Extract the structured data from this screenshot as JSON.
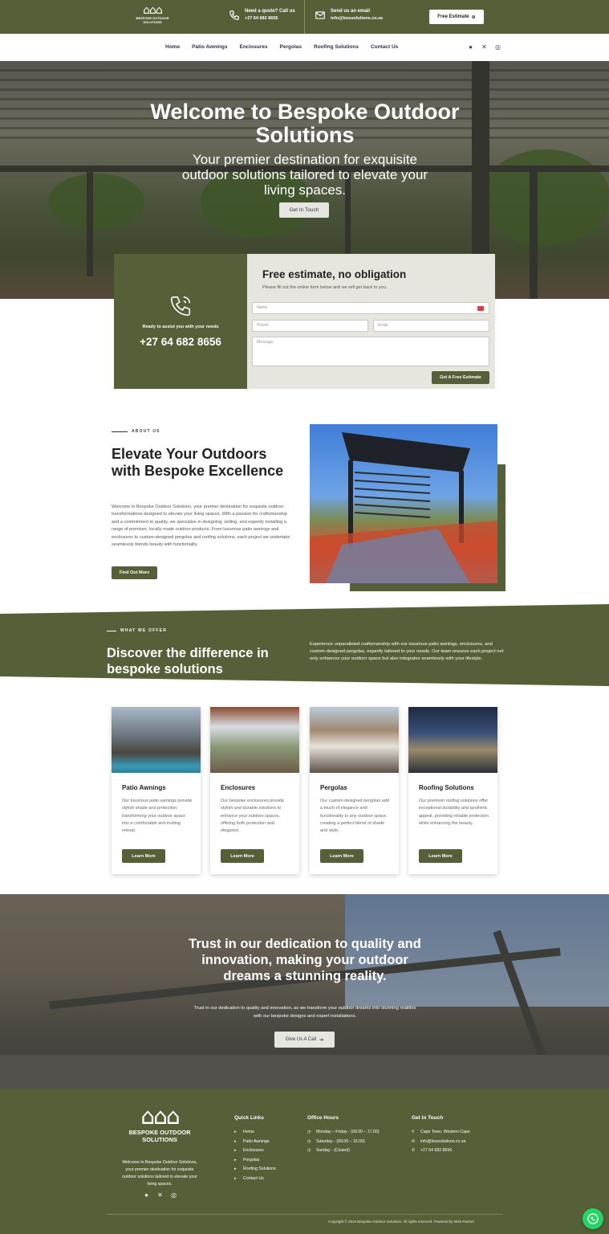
{
  "topbar": {
    "logo_text": "BESPOKE OUTDOOR SOLUTIONS",
    "quote_label": "Need a quote? Call us",
    "quote_phone": "+27 64 682 8656",
    "email_label": "Send us an email",
    "email_value": "info@bossolutions.co.za",
    "estimate_button": "Free Estimate"
  },
  "nav": {
    "items": [
      "Home",
      "Patio Awnings",
      "Enclosures",
      "Pergolas",
      "Roofing Solutions",
      "Contact Us"
    ],
    "social_icons": [
      "facebook-icon",
      "x-icon",
      "instagram-icon"
    ]
  },
  "hero": {
    "title": "Welcome to Bespoke Outdoor Solutions",
    "subtitle": "Your premier destination for exquisite outdoor solutions tailored to elevate your living spaces.",
    "button": "Get In Touch"
  },
  "estimate": {
    "ready_text": "Ready to assist you with your needs",
    "phone": "+27 64 682 8656",
    "title": "Free estimate, no obligation",
    "subtitle": "Please fill out the online form below and we will get back to you.",
    "name_placeholder": "Name",
    "phone_placeholder": "Phone",
    "email_placeholder": "Email",
    "message_placeholder": "Message",
    "submit": "Get A Free Estimate"
  },
  "about": {
    "label": "ABOUT US",
    "title": "Elevate Your Outdoors with Bespoke Excellence",
    "body": "Welcome to Bespoke Outdoor Solutions, your premier destination for exquisite outdoor transformations designed to elevate your living spaces. With a passion for craftsmanship and a commitment to quality, we specialize in designing, selling, and expertly installing a range of premium, locally made outdoor products. From luxurious patio awnings and enclosures to custom-designed pergolas and roofing solutions, each project we undertake seamlessly blends beauty with functionality.",
    "button": "Find Out More"
  },
  "offer": {
    "label": "WHAT WE OFFER",
    "title": "Discover the difference in bespoke solutions",
    "body": "Experience unparalleled craftsmanship with our luxurious patio awnings, enclosures, and custom-designed pergolas, expertly tailored to your needs. Our team ensures each project not only enhances your outdoor space but also integrates seamlessly with your lifestyle."
  },
  "services": [
    {
      "name": "Patio Awnings",
      "desc": "Our luxurious patio awnings provide stylish shade and protection, transforming your outdoor space into a comfortable and inviting retreat.",
      "button": "Learn More"
    },
    {
      "name": "Enclosures",
      "desc": "Our bespoke enclosures provide stylish and durable solutions to enhance your outdoor spaces, offering both protection and elegance.",
      "button": "Learn More"
    },
    {
      "name": "Pergolas",
      "desc": "Our custom-designed pergolas add a touch of elegance and functionality to any outdoor space, creating a perfect blend of shade and style.",
      "button": "Learn More"
    },
    {
      "name": "Roofing Solutions",
      "desc": "Our premium roofing solutions offer exceptional durability and aesthetic appeal, providing reliable protection while enhancing the beauty.",
      "button": "Learn More"
    }
  ],
  "trust": {
    "title": "Trust in our dedication to quality and innovation, making your outdoor dreams a stunning reality.",
    "body": "Trust in our dedication to quality and innovation, as we transform your outdoor dreams into stunning realities with our bespoke designs and expert installations.",
    "button": "Give Us A Call"
  },
  "footer": {
    "logo_text": "BESPOKE OUTDOOR SOLUTIONS",
    "about": "Welcome to Bespoke Outdoor Solutions, your premier destination for exquisite outdoor solutions tailored to elevate your living spaces.",
    "quick_links_title": "Quick Links",
    "quick_links": [
      "Home",
      "Patio Awnings",
      "Enclosures",
      "Pergolas",
      "Roofing Solutions",
      "Contact Us"
    ],
    "hours_title": "Office Hours",
    "hours": [
      "Monday – Friday - (09.00 – 17.00)",
      "Saturday - (09.00 – 15.00)",
      "Sunday - (Closed)"
    ],
    "contact_title": "Get In Touch",
    "contact": [
      "Cape Town, Western Cape",
      "info@bossolutions.co.za",
      "+27 64 682 8656"
    ],
    "copyright": "Copyright © 2024 Bespoke Outdoor Solutions. All rights reserved. Powered by Web Partner"
  },
  "colors": {
    "brand": "#555f38",
    "light": "#e6e5de"
  }
}
